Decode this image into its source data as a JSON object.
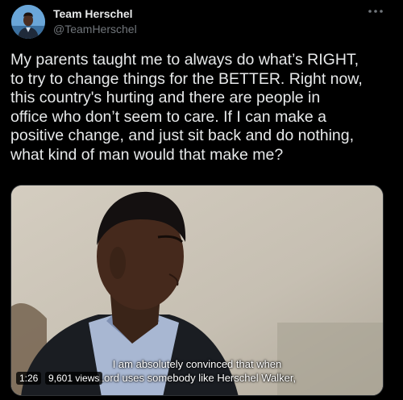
{
  "author": {
    "display_name": "Team Herschel",
    "handle": "@TeamHerschel",
    "avatar_icon": "profile-photo",
    "more_icon": "more-horizontal-icon"
  },
  "tweet": {
    "text": "My parents taught me to always do what’s RIGHT,\nto try to change things for the BETTER. Right now,\nthis country's hurting and there are people in\noffice who don’t seem to care. If I can make a\npositive change, and just sit back and do nothing,\nwhat kind of man would that make me?"
  },
  "video": {
    "caption_line_1": "I am absolutely convinced that when",
    "caption_line_2": "Lord uses somebody like Herschel Walker,",
    "duration": "1:26",
    "views": "9,601 views"
  },
  "colors": {
    "background": "#000000",
    "text_primary": "#e7e9ea",
    "text_secondary": "#71767b",
    "border": "#2f3336"
  }
}
